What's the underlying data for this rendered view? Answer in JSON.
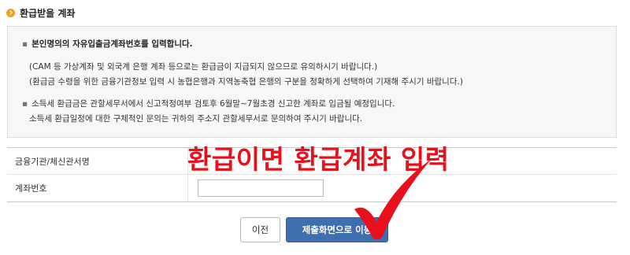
{
  "section": {
    "title": "환급받을 계좌"
  },
  "notice": {
    "lines": [
      "본인명의의 자유입출금계좌번호를 입력합니다.",
      "(CAM 등 가상계좌 및 외국계 은행 계좌 등으로는 환급금이 지급되지 않으므로 유의하시기 바랍니다.)",
      "(환급금 수령을 위한 금융기관정보 입력 시 농협은행과 지역농축협 은행의 구분을 정확하게 선택하여 기재해 주시기 바랍니다.)",
      "소득세 환급금은 관할세무서에서 신고적정여부 검토후 6월말~7월초경 신고한 계좌로 입금될 예정입니다.",
      "소득세 환급일정에 대한 구체적인 문의는 귀하의 주소지 관할세무서로 문의하여 주시기 바랍니다."
    ],
    "bullet": "▪"
  },
  "form": {
    "bank_label": "금융기관/체신관서명",
    "bank_value": "",
    "account_label": "계좌번호",
    "account_value": "",
    "account_placeholder": ""
  },
  "buttons": {
    "prev_label": "이전",
    "next_label": "제출화면으로 이동"
  },
  "annotation": {
    "text": "환급이면 환급계좌 입력",
    "color": "#e8101a"
  },
  "colors": {
    "primary_button": "#3f6fae",
    "notice_bg": "#f7f7f7",
    "title_icon": "#f0a01e"
  }
}
